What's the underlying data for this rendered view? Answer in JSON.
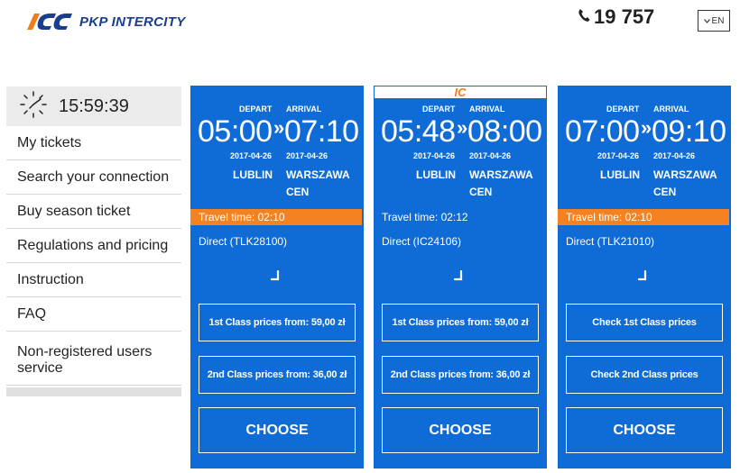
{
  "header": {
    "logo_text": "PKP INTERCITY",
    "phone": "19 757",
    "lang": "EN"
  },
  "sidebar": {
    "clock": "15:59:39",
    "items": [
      {
        "label": "My tickets"
      },
      {
        "label": "Search your connection"
      },
      {
        "label": "Buy season ticket"
      },
      {
        "label": "Regulations and pricing"
      },
      {
        "label": "Instruction"
      },
      {
        "label": "FAQ"
      },
      {
        "label": "Non-registered users service"
      }
    ]
  },
  "labels": {
    "depart": "DEPART",
    "arrival": "ARRIVAL",
    "choose": "CHOOSE"
  },
  "connections": [
    {
      "depart_time": "05:00",
      "arrival_time": "07:10",
      "depart_date": "2017-04-26",
      "arrival_date": "2017-04-26",
      "from": "LUBLIN",
      "to": "WARSZAWA CEN",
      "travel_time": "Travel time: 02:10",
      "travel_highlight": true,
      "train": "Direct (TLK28100)",
      "first_class": "1st Class prices from: 59,00 zł",
      "second_class": "2nd Class prices from: 36,00 zł",
      "carrier_badge": ""
    },
    {
      "depart_time": "05:48",
      "arrival_time": "08:00",
      "depart_date": "2017-04-26",
      "arrival_date": "2017-04-26",
      "from": "LUBLIN",
      "to": "WARSZAWA CEN",
      "travel_time": "Travel time: 02:12",
      "travel_highlight": false,
      "train": "Direct (IC24106)",
      "first_class": "1st Class prices from: 59,00 zł",
      "second_class": "2nd Class prices from: 36,00 zł",
      "carrier_badge": "IC"
    },
    {
      "depart_time": "07:00",
      "arrival_time": "09:10",
      "depart_date": "2017-04-26",
      "arrival_date": "2017-04-26",
      "from": "LUBLIN",
      "to": "WARSZAWA CEN",
      "travel_time": "Travel time: 02:10",
      "travel_highlight": true,
      "train": "Direct (TLK21010)",
      "first_class": "Check 1st Class prices",
      "second_class": "Check 2nd Class prices",
      "carrier_badge": ""
    }
  ],
  "colors": {
    "card_blue": "#0f6cd6",
    "highlight_orange": "#f58220",
    "brand_navy": "#1a3e8e"
  }
}
